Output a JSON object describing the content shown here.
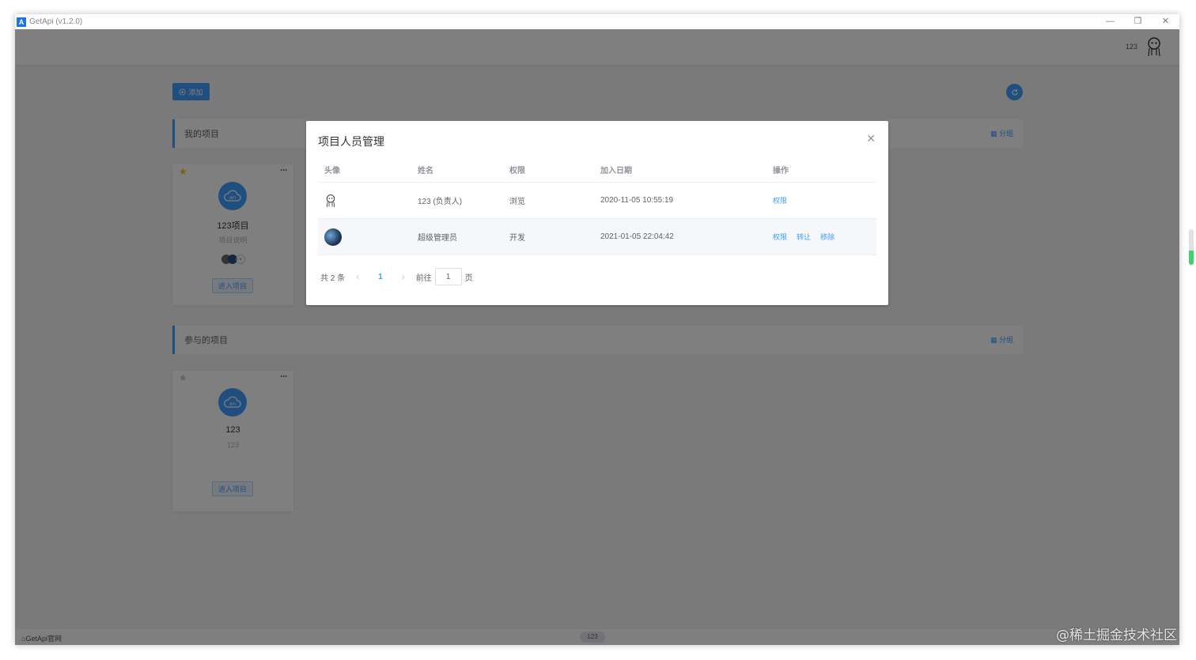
{
  "window": {
    "title": "GetApi (v1.2.0)",
    "logo_letter": "A",
    "minimize_icon": "—",
    "restore_icon": "❐",
    "close_icon": "✕"
  },
  "header": {
    "user_name": "123"
  },
  "toolbar": {
    "add_label": "添加"
  },
  "my_projects": {
    "heading": "我的项目",
    "group_label": "分组",
    "cards": [
      {
        "title": "123项目",
        "desc": "项目说明",
        "enter_label": "进入项目",
        "starred": true
      }
    ]
  },
  "joined_projects": {
    "heading": "参与的项目",
    "group_label": "分组",
    "cards": [
      {
        "title": "123",
        "desc": "123",
        "enter_label": "进入项目",
        "starred": false
      }
    ]
  },
  "footer": {
    "home_link": "GetApi官网",
    "center_badge": "123"
  },
  "dialog": {
    "title": "项目人员管理",
    "columns": [
      "头像",
      "姓名",
      "权限",
      "加入日期",
      "操作"
    ],
    "rows": [
      {
        "name": "123 (负责人)",
        "permission": "浏览",
        "joined": "2020-11-05 10:55:19",
        "actions": [
          "权限"
        ]
      },
      {
        "name": "超级管理员",
        "permission": "开发",
        "joined": "2021-01-05 22:04:42",
        "actions": [
          "权限",
          "转让",
          "移除"
        ]
      }
    ],
    "pagination": {
      "total_label": "共 2 条",
      "current_page": "1",
      "goto_label": "前往",
      "goto_value": "1",
      "page_suffix": "页"
    }
  },
  "watermark": "@稀土掘金技术社区",
  "colors": {
    "primary": "#409eff",
    "star_active": "#f7ba2a",
    "star_inactive": "#c0c4cc",
    "overlay": "rgba(0,0,0,0.5)"
  },
  "icons": [
    "app-logo-icon",
    "minimize-icon",
    "restore-icon",
    "close-icon",
    "avatar-icon",
    "plus-circle-icon",
    "refresh-icon",
    "grid-icon",
    "star-icon",
    "more-dots-icon",
    "cloud-api-icon",
    "chevron-left-icon",
    "chevron-right-icon",
    "dialog-close-icon"
  ]
}
